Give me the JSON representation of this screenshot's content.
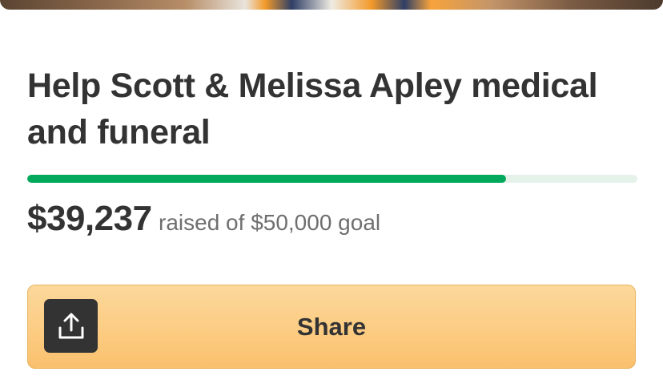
{
  "campaign": {
    "title": "Help Scott & Melissa Apley medical and funeral",
    "raised_amount": "$39,237",
    "raised_text": "raised of $50,000 goal",
    "progress_fraction": 0.7847
  },
  "share": {
    "label": "Share",
    "icon": "share-upload-icon"
  },
  "colors": {
    "progress_fill": "#02a95c",
    "progress_track": "#e4f2ea",
    "share_button_bg": "#fbcc80",
    "icon_box": "#333333"
  }
}
